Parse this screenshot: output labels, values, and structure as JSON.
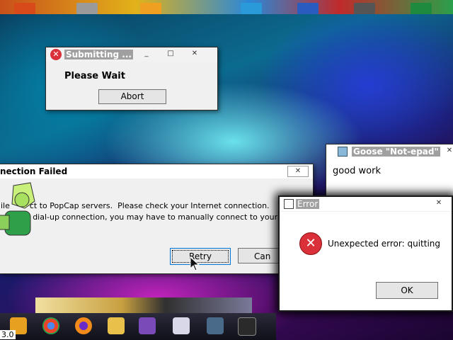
{
  "submitting_window": {
    "title": "Submitting ...",
    "message": "Please Wait",
    "abort_label": "Abort"
  },
  "goose_window": {
    "title": "Goose \"Not-epad\"",
    "text": "good work"
  },
  "connection_window": {
    "title": "nection Failed",
    "line1": "ile        ct to PopCap servers.  Please check your Internet connection.",
    "line2": "          a dial-up connection, you may have to manually connect to your",
    "retry_label": "Retry",
    "cancel_label": "Can"
  },
  "error_window": {
    "title": "Error",
    "message": "Unexpected error: quitting",
    "ok_label": "OK"
  },
  "taskbar": {
    "corner_text": "3.0"
  },
  "colors": {
    "error_red": "#d9303a",
    "focus_blue": "#0078d7"
  }
}
